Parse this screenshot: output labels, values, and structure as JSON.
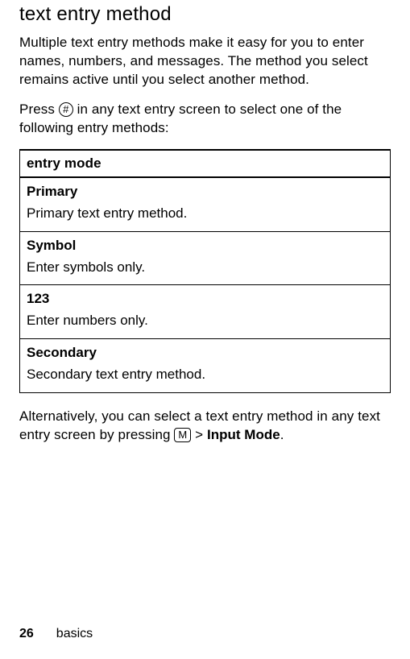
{
  "heading": "text entry method",
  "para1": "Multiple text entry methods make it easy for you to enter names, numbers, and messages. The method you select remains active until you select another method.",
  "para2_pre": "Press ",
  "para2_key": "#",
  "para2_post": " in any text entry screen to select one of the following entry methods:",
  "table": {
    "header": "entry mode",
    "rows": [
      {
        "title": "Primary",
        "desc": "Primary text entry method."
      },
      {
        "title": "Symbol",
        "desc": "Enter symbols only."
      },
      {
        "title": "123",
        "desc": "Enter numbers only."
      },
      {
        "title": "Secondary",
        "desc": "Secondary text entry method."
      }
    ]
  },
  "para3_pre": "Alternatively, you can select a text entry method in any text entry screen by pressing ",
  "para3_key": "M",
  "para3_sep": " > ",
  "para3_menu": "Input Mode",
  "para3_end": ".",
  "footer": {
    "page": "26",
    "section": "basics"
  }
}
